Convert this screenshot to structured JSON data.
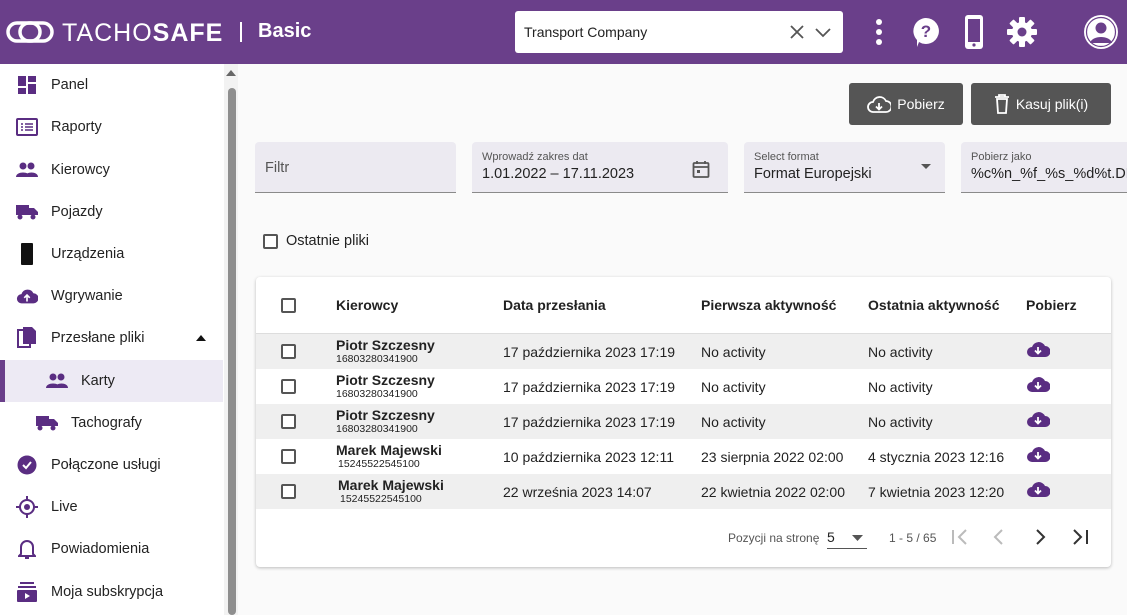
{
  "header": {
    "brand_light": "TACHO",
    "brand_bold": "SAFE",
    "edition": "Basic",
    "company": "Transport Company",
    "icons": [
      "more-vert-icon",
      "help-icon",
      "phone-icon",
      "settings-icon",
      "account-icon"
    ],
    "color": "#6a3f8a"
  },
  "sidebar": {
    "items": [
      {
        "label": "Panel",
        "icon": "dashboard-icon"
      },
      {
        "label": "Raporty",
        "icon": "reports-icon"
      },
      {
        "label": "Kierowcy",
        "icon": "people-icon"
      },
      {
        "label": "Pojazdy",
        "icon": "truck-icon"
      },
      {
        "label": "Urządzenia",
        "icon": "device-icon"
      },
      {
        "label": "Wgrywanie",
        "icon": "cloud-upload-icon"
      },
      {
        "label": "Przesłane pliki",
        "icon": "files-icon"
      },
      {
        "label": "Karty",
        "icon": "people-icon"
      },
      {
        "label": "Tachografy",
        "icon": "truck-icon"
      },
      {
        "label": "Połączone usługi",
        "icon": "connected-services-icon"
      },
      {
        "label": "Live",
        "icon": "location-icon"
      },
      {
        "label": "Powiadomienia",
        "icon": "bell-icon"
      },
      {
        "label": "Moja subskrypcja",
        "icon": "subscription-icon"
      }
    ]
  },
  "toolbar": {
    "download_label": "Pobierz",
    "delete_label": "Kasuj plik(i)"
  },
  "filters": {
    "filter_placeholder": "Filtr",
    "date_label": "Wprowadź zakres dat",
    "date_value": "1.01.2022 – 17.11.2023",
    "format_label": "Select format",
    "format_value": "Format Europejski",
    "save_as_label": "Pobierz jako",
    "save_as_value": "%c%n_%f_%s_%d%t.DDD",
    "recent_files_label": "Ostatnie pliki"
  },
  "table": {
    "columns": [
      "Kierowcy",
      "Data przesłania",
      "Pierwsza aktywność",
      "Ostatnia aktywność",
      "Pobierz"
    ],
    "rows": [
      {
        "name": "Piotr Szczesny",
        "card": "16803280341900",
        "uploaded": "17 października 2023 17:19",
        "first": "No activity",
        "last": "No activity"
      },
      {
        "name": "Piotr Szczesny",
        "card": "16803280341900",
        "uploaded": "17 października 2023 17:19",
        "first": "No activity",
        "last": "No activity"
      },
      {
        "name": "Piotr Szczesny",
        "card": "16803280341900",
        "uploaded": "17 października 2023 17:19",
        "first": "No activity",
        "last": "No activity"
      },
      {
        "name": "Marek Majewski",
        "card": "15245522545100",
        "uploaded": "10 października 2023 12:11",
        "first": "23 sierpnia 2022 02:00",
        "last": "4 stycznia 2023 12:16"
      },
      {
        "name": "Marek Majewski",
        "card": "15245522545100",
        "uploaded": "22 września 2023 14:07",
        "first": "22 kwietnia 2022 02:00",
        "last": "7 kwietnia 2023 12:20"
      }
    ]
  },
  "pagination": {
    "per_page_label": "Pozycji na stronę",
    "per_page_value": "5",
    "range": "1 - 5 / 65"
  }
}
